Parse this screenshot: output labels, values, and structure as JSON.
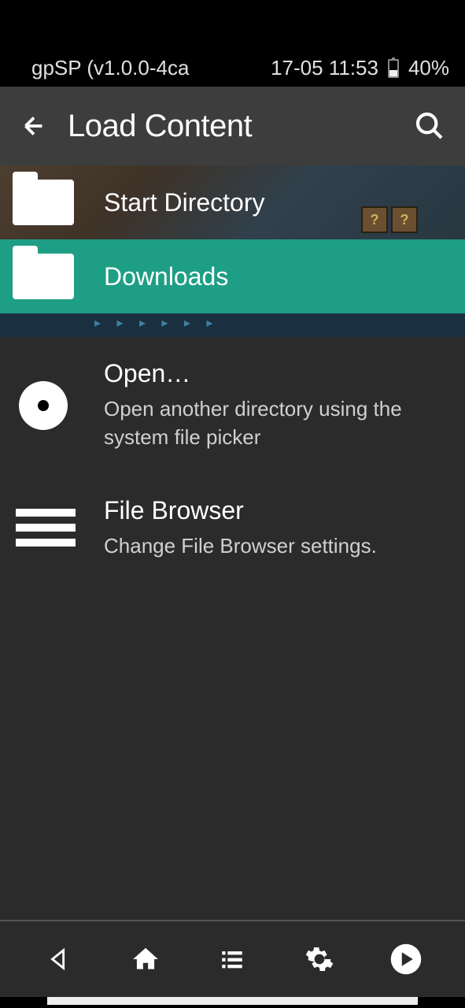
{
  "status": {
    "app": "gpSP (v1.0.0-4ca",
    "time": "17-05 11:53",
    "battery": "40%"
  },
  "header": {
    "title": "Load Content"
  },
  "items": {
    "start_directory": {
      "title": "Start Directory"
    },
    "downloads": {
      "title": "Downloads"
    },
    "open": {
      "title": "Open…",
      "subtitle": "Open another directory using the system file picker"
    },
    "file_browser": {
      "title": "File Browser",
      "subtitle": "Change File Browser settings."
    }
  }
}
